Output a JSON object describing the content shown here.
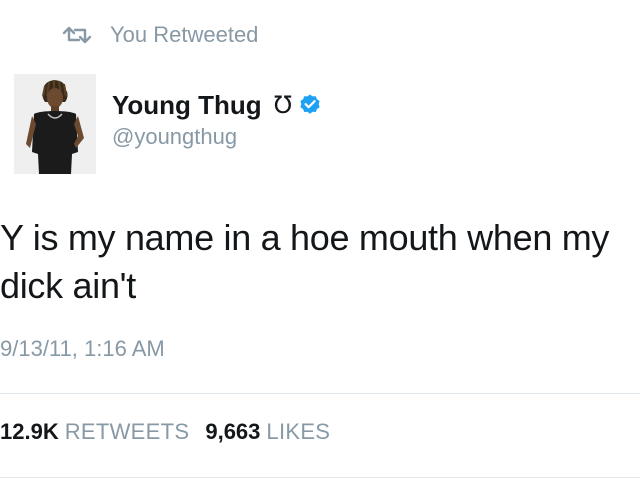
{
  "retweet_context": {
    "icon": "retweet-icon",
    "label": "You Retweeted"
  },
  "author": {
    "avatar": "profile-photo",
    "display_name": "Young Thug",
    "name_glyph": "Ʊ",
    "verified": true,
    "verified_icon": "verified-badge-icon",
    "handle": "@youngthug"
  },
  "tweet": {
    "lines": [
      "Y is my name in a hoe mouth when my",
      "dick ain't"
    ],
    "timestamp": "9/13/11, 1:16 AM"
  },
  "stats": {
    "retweets_count": "12.9K",
    "retweets_label": "RETWEETS",
    "likes_count": "9,663",
    "likes_label": "LIKES"
  },
  "colors": {
    "text_primary": "#14171a",
    "text_secondary": "#8899a6",
    "verified_blue": "#1da1f2",
    "divider": "#e1e8ed"
  }
}
